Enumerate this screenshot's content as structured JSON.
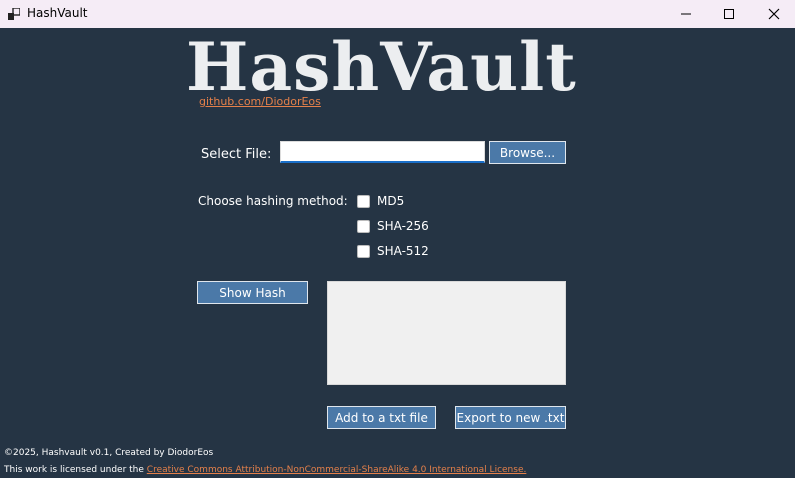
{
  "window": {
    "title": "HashVault",
    "icon": "app-window-icon",
    "controls": [
      "minimize",
      "maximize",
      "close"
    ]
  },
  "header": {
    "logo_text": "HashVault",
    "repo_link": "github.com/DiodorEos"
  },
  "file": {
    "label": "Select File:",
    "path_value": "",
    "browse_label": "Browse..."
  },
  "hashing": {
    "label": "Choose hashing method:",
    "options": [
      {
        "label": "MD5",
        "checked": false
      },
      {
        "label": "SHA-256",
        "checked": false
      },
      {
        "label": "SHA-512",
        "checked": false
      }
    ]
  },
  "actions": {
    "show_hash_label": "Show Hash",
    "add_txt_label": "Add to a txt file",
    "export_label": "Export to new .txt"
  },
  "output": {
    "value": ""
  },
  "footer": {
    "credit": "©2025, Hashvault v0.1, Created by DiodorEos",
    "license_prefix": "This work is licensed under the",
    "license_link": "Creative Commons Attribution-NonCommercial-ShareAlike 4.0 International License."
  },
  "colors": {
    "background": "#253444",
    "titlebar": "#f5ecf6",
    "button": "#4b79a8",
    "link": "#e4804a",
    "input_focus": "#1a6fc9"
  }
}
